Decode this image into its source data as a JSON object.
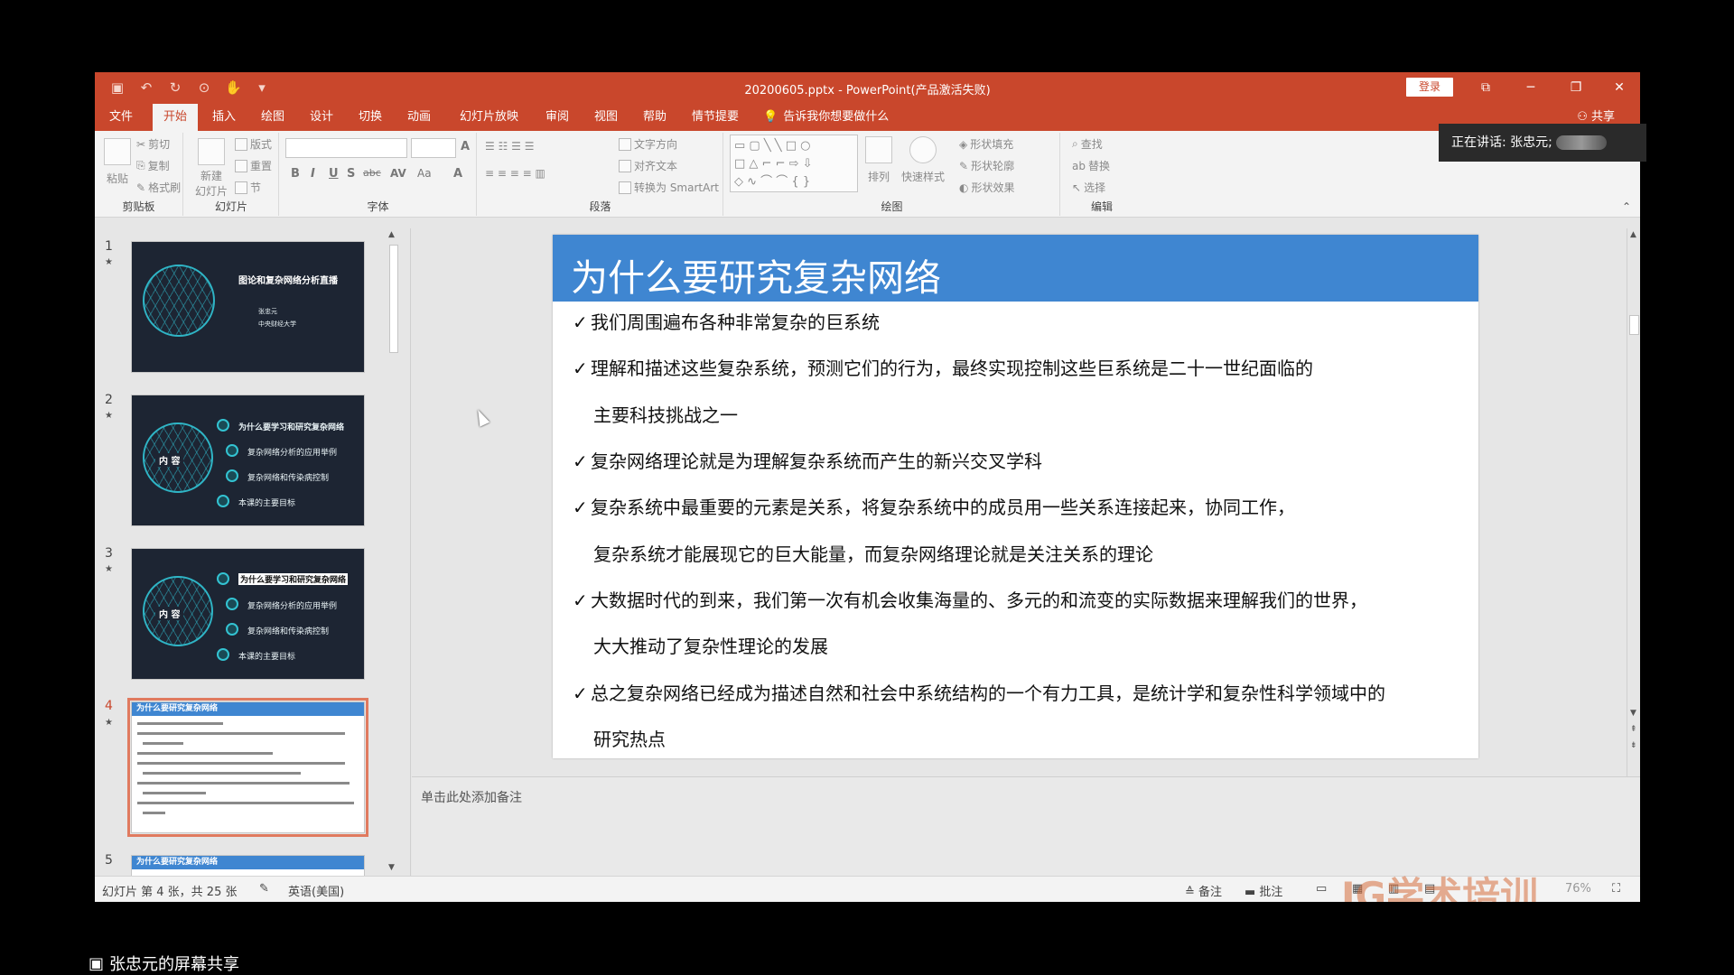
{
  "window": {
    "title": "20200605.pptx - PowerPoint(产品激活失败)",
    "login": "登录",
    "share": "共享",
    "controls": {
      "restore_ribbon": "⧉",
      "minimize": "─",
      "maximize": "❐",
      "close": "✕"
    }
  },
  "qat": [
    "save-icon",
    "undo-icon",
    "redo-icon",
    "slideshow-icon",
    "touch-icon",
    "customize-icon"
  ],
  "tabs": [
    "文件",
    "开始",
    "插入",
    "绘图",
    "设计",
    "切换",
    "动画",
    "幻灯片放映",
    "审阅",
    "视图",
    "帮助",
    "情节提要"
  ],
  "active_tab": "开始",
  "tell_me": "告诉我你想要做什么",
  "ribbon": {
    "clipboard": {
      "label": "剪贴板",
      "paste": "粘贴",
      "cut": "剪切",
      "copy": "复制",
      "format_painter": "格式刷"
    },
    "slides": {
      "label": "幻灯片",
      "new_slide": "新建",
      "new_slide2": "幻灯片",
      "layout": "版式",
      "reset": "重置",
      "section": "节"
    },
    "font": {
      "label": "字体",
      "grow": "A",
      "shrink": "A",
      "bold": "B",
      "italic": "I",
      "underline": "U",
      "shadow": "S",
      "strike": "abc",
      "spacing": "AV",
      "case": "Aa",
      "color": "A"
    },
    "paragraph": {
      "label": "段落",
      "text_direction": "文字方向",
      "align_text": "对齐文本",
      "smartart": "转换为 SmartArt"
    },
    "drawing": {
      "label": "绘图",
      "arrange": "排列",
      "quick_styles": "快速样式",
      "fill": "形状填充",
      "outline": "形状轮廓",
      "effects": "形状效果"
    },
    "editing": {
      "label": "编辑",
      "find": "查找",
      "replace": "替换",
      "select": "选择"
    }
  },
  "speaker": {
    "prefix": "正在讲话: 张忠元;"
  },
  "thumbnails": [
    {
      "num": "1",
      "title": "图论和复杂网络分析直播",
      "sub1": "张忠元",
      "sub2": "中央财经大学"
    },
    {
      "num": "2",
      "center": "内  容",
      "items": [
        "为什么要学习和研究复杂网络",
        "复杂网络分析的应用举例",
        "复杂网络和传染病控制",
        "本课的主要目标"
      ]
    },
    {
      "num": "3",
      "center": "内  容",
      "items": [
        "为什么要学习和研究复杂网络",
        "复杂网络分析的应用举例",
        "复杂网络和传染病控制",
        "本课的主要目标"
      ]
    },
    {
      "num": "4",
      "title": "为什么要研究复杂网络"
    },
    {
      "num": "5",
      "title": "为什么要研究复杂网络"
    }
  ],
  "slide": {
    "title": "为什么要研究复杂网络",
    "bullets": [
      {
        "text": "我们周围遍布各种非常复杂的巨系统"
      },
      {
        "text": "理解和描述这些复杂系统，预测它们的行为，最终实现控制这些巨系统是二十一世纪面临的",
        "cont": "主要科技挑战之一"
      },
      {
        "text": "复杂网络理论就是为理解复杂系统而产生的新兴交叉学科"
      },
      {
        "text": "复杂系统中最重要的元素是关系，将复杂系统中的成员用一些关系连接起来，协同工作，",
        "cont": "复杂系统才能展现它的巨大能量，而复杂网络理论就是关注关系的理论"
      },
      {
        "text": "大数据时代的到来，我们第一次有机会收集海量的、多元的和流变的实际数据来理解我们的世界，",
        "cont": "大大推动了复杂性理论的发展"
      },
      {
        "text": "总之复杂网络已经成为描述自然和社会中系统结构的一个有力工具，是统计学和复杂性科学领域中的",
        "cont": "研究热点"
      }
    ]
  },
  "notes_placeholder": "单击此处添加备注",
  "status": {
    "slide_info": "幻灯片 第 4 张，共 25 张",
    "language": "英语(美国)",
    "notes": "备注",
    "comments": "批注",
    "zoom": "76%"
  },
  "watermark": "JG学术培训",
  "screen_share": "张忠元的屏幕共享",
  "colors": {
    "titlebar": "#c9472c",
    "slide_header": "#3f86d1",
    "ribbon": "#f3f3f3"
  }
}
